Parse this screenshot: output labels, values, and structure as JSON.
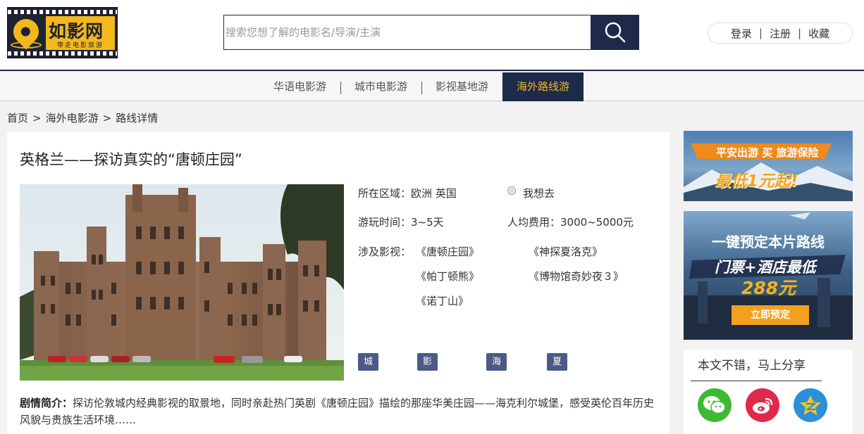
{
  "logo": {
    "name": "如影网",
    "slogan": "带走电影旅游"
  },
  "search": {
    "placeholder": "搜索您想了解的电影名/导演/主演"
  },
  "user": {
    "login": "登录",
    "register": "注册",
    "favorites": "收藏",
    "separator": "|"
  },
  "nav": {
    "items": [
      {
        "label": "华语电影游"
      },
      {
        "label": "城市电影游"
      },
      {
        "label": "影视基地游"
      },
      {
        "label": "海外路线游",
        "active": true
      }
    ]
  },
  "breadcrumb": {
    "home": "首页",
    "section": "海外电影游",
    "current": "路线详情",
    "separator": ">"
  },
  "route": {
    "title": "英格兰——探访真实的“唐顿庄园”",
    "region_label": "所在区域：",
    "region": "欧洲 英国",
    "want_go": "我想去",
    "duration_label": "游玩时间：",
    "duration": "3~5天",
    "cost_label": "人均费用：",
    "cost": "3000~5000元",
    "films_label": "涉及影视：",
    "films": [
      "《唐顿庄园》",
      "《神探夏洛克》",
      "《帕丁顿熊》",
      "《博物馆奇妙夜３》",
      "《诺丁山》"
    ],
    "tags": [
      "城市游",
      "影视基地",
      "海外游",
      "夏季最佳"
    ],
    "synopsis_label": "剧情简介：",
    "synopsis": "探访伦敦城内经典影视的取景地，同时亲赴热门英剧《唐顿庄园》描绘的那座华美庄园——海克利尔城堡，感受英伦百年历史风貌与贵族生活环境……"
  },
  "ads": {
    "insurance": {
      "line1": "平安出游 买 旅游保险",
      "line2": "最低1元起!"
    },
    "booking": {
      "line1": "一键预定本片路线",
      "line2": "门票+酒店最低",
      "price": "288元",
      "button": "立即预定"
    }
  },
  "share": {
    "title": "本文不错，马上分享"
  },
  "colors": {
    "navy": "#1e2a4a",
    "gold": "#f3b81c",
    "tag": "#4b5a86",
    "orange": "#f08a1c"
  }
}
